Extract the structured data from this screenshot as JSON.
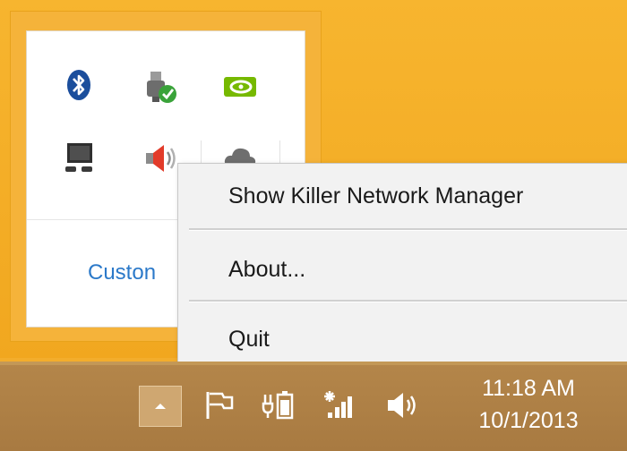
{
  "tray_overflow": {
    "icons": [
      "bluetooth-icon",
      "usb-safely-remove-icon",
      "nvidia-icon",
      "display-icon",
      "speaker-icon",
      "cloud-icon"
    ],
    "customize_link": "Custon"
  },
  "context_menu": {
    "items": [
      {
        "label": "Show Killer Network Manager"
      },
      {
        "label": "About..."
      },
      {
        "label": "Quit"
      }
    ]
  },
  "taskbar": {
    "icons": [
      "chevron-up-icon",
      "flag-icon",
      "battery-icon",
      "wifi-icon",
      "volume-icon"
    ],
    "clock": {
      "time": "11:18 AM",
      "date": "10/1/2013"
    }
  },
  "colors": {
    "desktop": "#f3ad2c",
    "taskbar": "#ac7e44",
    "menu_bg": "#f2f2f2",
    "link": "#2b79c9"
  }
}
